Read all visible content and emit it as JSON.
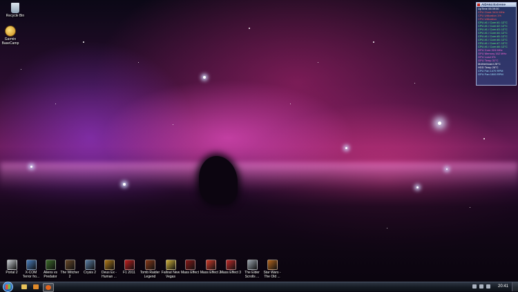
{
  "desktop": {
    "top_icons": [
      {
        "label": "Recycle Bin",
        "icon": "recycle-bin-icon"
      },
      {
        "label": "Garmin\nBaseCamp",
        "icon": "basecamp-icon"
      }
    ],
    "game_icons": [
      {
        "label": "Portal 2",
        "color": "#c9cdd3"
      },
      {
        "label": "X-COM\nTerror fro...",
        "color": "#4a7fc0"
      },
      {
        "label": "Aliens vs\nPredator",
        "color": "#3c6b2a"
      },
      {
        "label": "The Witcher\n2",
        "color": "#6a4a2a"
      },
      {
        "label": "Crysis 2",
        "color": "#5b7fa6"
      },
      {
        "label": "Deus Ex -\nHuman ...",
        "color": "#b07a1a"
      },
      {
        "label": "F1 2011",
        "color": "#c21f1f"
      },
      {
        "label": "Tomb Raider\nLegend",
        "color": "#8a3a1a"
      },
      {
        "label": "Fallout New\nVegas",
        "color": "#d1b23a"
      },
      {
        "label": "Mass Effect",
        "color": "#8a1a1a"
      },
      {
        "label": "Mass Effect 2",
        "color": "#d23a2a"
      },
      {
        "label": "Mass Effect 3",
        "color": "#c22a2a"
      },
      {
        "label": "The Elder\nScrolls ...",
        "color": "#9aa3ad"
      },
      {
        "label": "Star Wars -\nThe Old ...",
        "color": "#b5651d"
      }
    ]
  },
  "sensor_panel": {
    "title": "AIDA64 Extreme",
    "rows": [
      {
        "text": "UpTime 05:39:00",
        "color": "#ffffff"
      },
      {
        "text": "CPU Clock 3411 MHz",
        "color": "#ff5a5a"
      },
      {
        "text": "CPU Utilization 1%",
        "color": "#ff5a5a"
      },
      {
        "text": "CPU Utilization",
        "color": "#ff5a5a"
      },
      {
        "text": "CPU #1 / Core #1: 12°C",
        "color": "#5cff7a"
      },
      {
        "text": "CPU #1 / Core #2: 12°C",
        "color": "#5cff7a"
      },
      {
        "text": "CPU #1 / Core #3: 12°C",
        "color": "#5cff7a"
      },
      {
        "text": "CPU #1 / Core #4: 12°C",
        "color": "#5cff7a"
      },
      {
        "text": "CPU #1 / Core #5: 12°C",
        "color": "#5cff7a"
      },
      {
        "text": "CPU #1 / Core #6: 12°C",
        "color": "#5cff7a"
      },
      {
        "text": "CPU #1 / Core #7: 12°C",
        "color": "#5cff7a"
      },
      {
        "text": "CPU #1 / Core #8: 12°C",
        "color": "#5cff7a"
      },
      {
        "text": "GPU Core 324 MHz",
        "color": "#ff6ad8"
      },
      {
        "text": "GPU Memory 162 MHz",
        "color": "#ff6ad8"
      },
      {
        "text": "GPU Load 0%",
        "color": "#ff6ad8"
      },
      {
        "text": "GPU Temp 31°C",
        "color": "#ff6ad8"
      },
      {
        "text": "Motherboard 28°C",
        "color": "#ffffff"
      },
      {
        "text": "HDD Temp 26°C",
        "color": "#ffffff"
      },
      {
        "text": "CPU Fan 1479 RPM",
        "color": "#9fe0ff"
      },
      {
        "text": "GPU Fan 1500 RPM",
        "color": "#9fe0ff"
      }
    ]
  },
  "taskbar": {
    "pinned": [
      {
        "icon": "explorer-folder-icon",
        "color": "#e8c25a"
      },
      {
        "icon": "media-player-icon",
        "color": "#e08a2a"
      },
      {
        "icon": "firefox-icon",
        "color": "#e3641c"
      }
    ],
    "clock": "20:41"
  }
}
